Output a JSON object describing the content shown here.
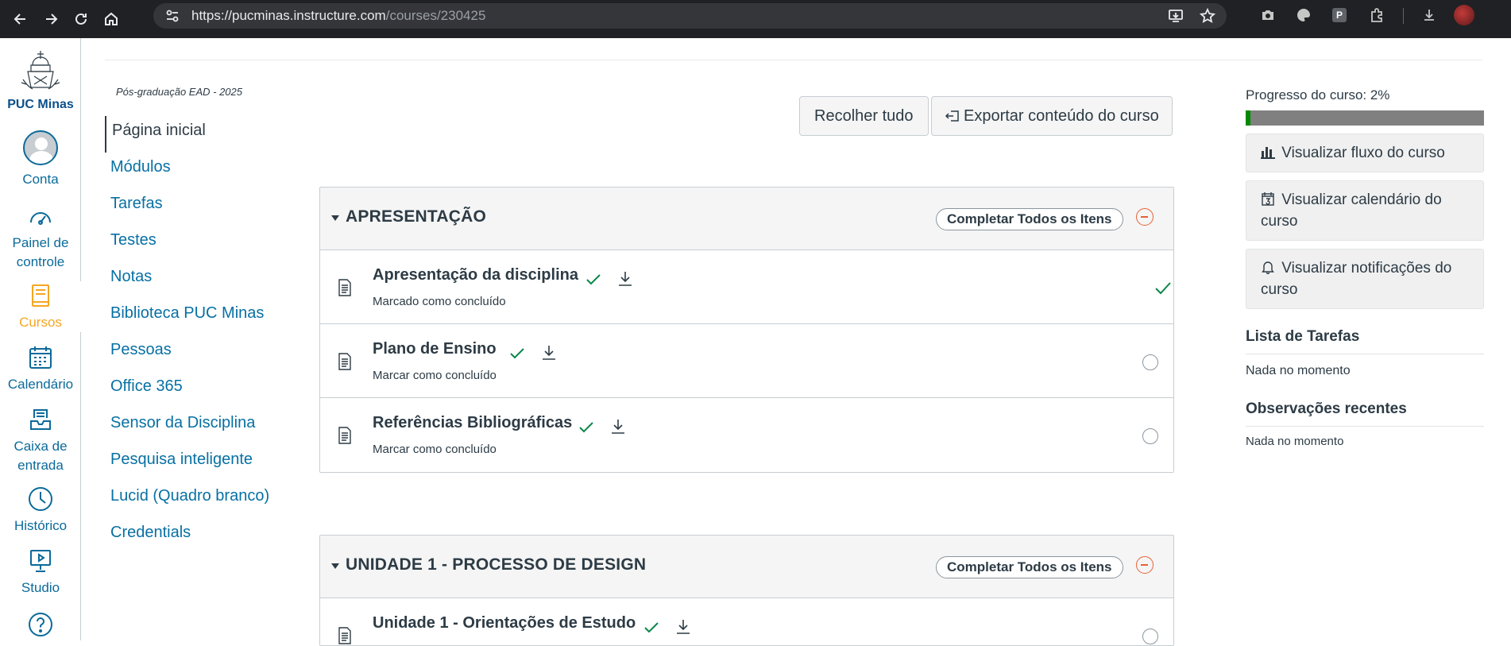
{
  "browser": {
    "url_host": "https://pucminas.instructure.com",
    "url_path": "/courses/230425"
  },
  "global_nav": {
    "logo_text": "PUC Minas",
    "items": [
      {
        "label": "Conta",
        "icon": "account-avatar-icon"
      },
      {
        "label": "Painel de controle",
        "icon": "dashboard-icon"
      },
      {
        "label": "Cursos",
        "icon": "courses-icon",
        "active": true
      },
      {
        "label": "Calendário",
        "icon": "calendar-icon"
      },
      {
        "label": "Caixa de entrada",
        "icon": "inbox-icon"
      },
      {
        "label": "Histórico",
        "icon": "clock-icon"
      },
      {
        "label": "Studio",
        "icon": "studio-icon"
      },
      {
        "label": "",
        "icon": "help-icon"
      }
    ],
    "accent_color": "#0b6a9a",
    "active_color": "#f5a623"
  },
  "breadcrumb": "Pós-graduação EAD - 2025",
  "course_nav": [
    "Página inicial",
    "Módulos",
    "Tarefas",
    "Testes",
    "Notas",
    "Biblioteca PUC Minas",
    "Pessoas",
    "Office 365",
    "Sensor da Disciplina",
    "Pesquisa inteligente",
    "Lucid (Quadro branco)",
    "Credentials"
  ],
  "toolbar": {
    "collapse_all": "Recolher tudo",
    "export": "Exportar conteúdo do curso"
  },
  "modules": [
    {
      "title": "APRESENTAÇÃO",
      "complete_all": "Completar Todos os Itens",
      "items": [
        {
          "title": "Apresentação da disciplina",
          "status": "Marcado como concluído",
          "done": true
        },
        {
          "title": "Plano de Ensino",
          "status": "Marcar como concluído",
          "done": false
        },
        {
          "title": "Referências Bibliográficas",
          "status": "Marcar como concluído",
          "done": false
        }
      ]
    },
    {
      "title": "UNIDADE 1 - PROCESSO DE DESIGN",
      "complete_all": "Completar Todos os Itens",
      "items": [
        {
          "title": "Unidade 1 - Orientações de Estudo",
          "status": "",
          "done": false
        }
      ]
    }
  ],
  "sidebar": {
    "progress_label": "Progresso do curso: 2%",
    "progress_fraction": 0.02,
    "progress_color": "#008a00",
    "view_flow": "Visualizar fluxo do curso",
    "view_calendar": "Visualizar calendário do curso",
    "view_notifications": "Visualizar notificações do curso",
    "todo_heading": "Lista de Tarefas",
    "todo_empty": "Nada no momento",
    "feedback_heading": "Observações recentes",
    "feedback_empty": "Nada no momento"
  }
}
